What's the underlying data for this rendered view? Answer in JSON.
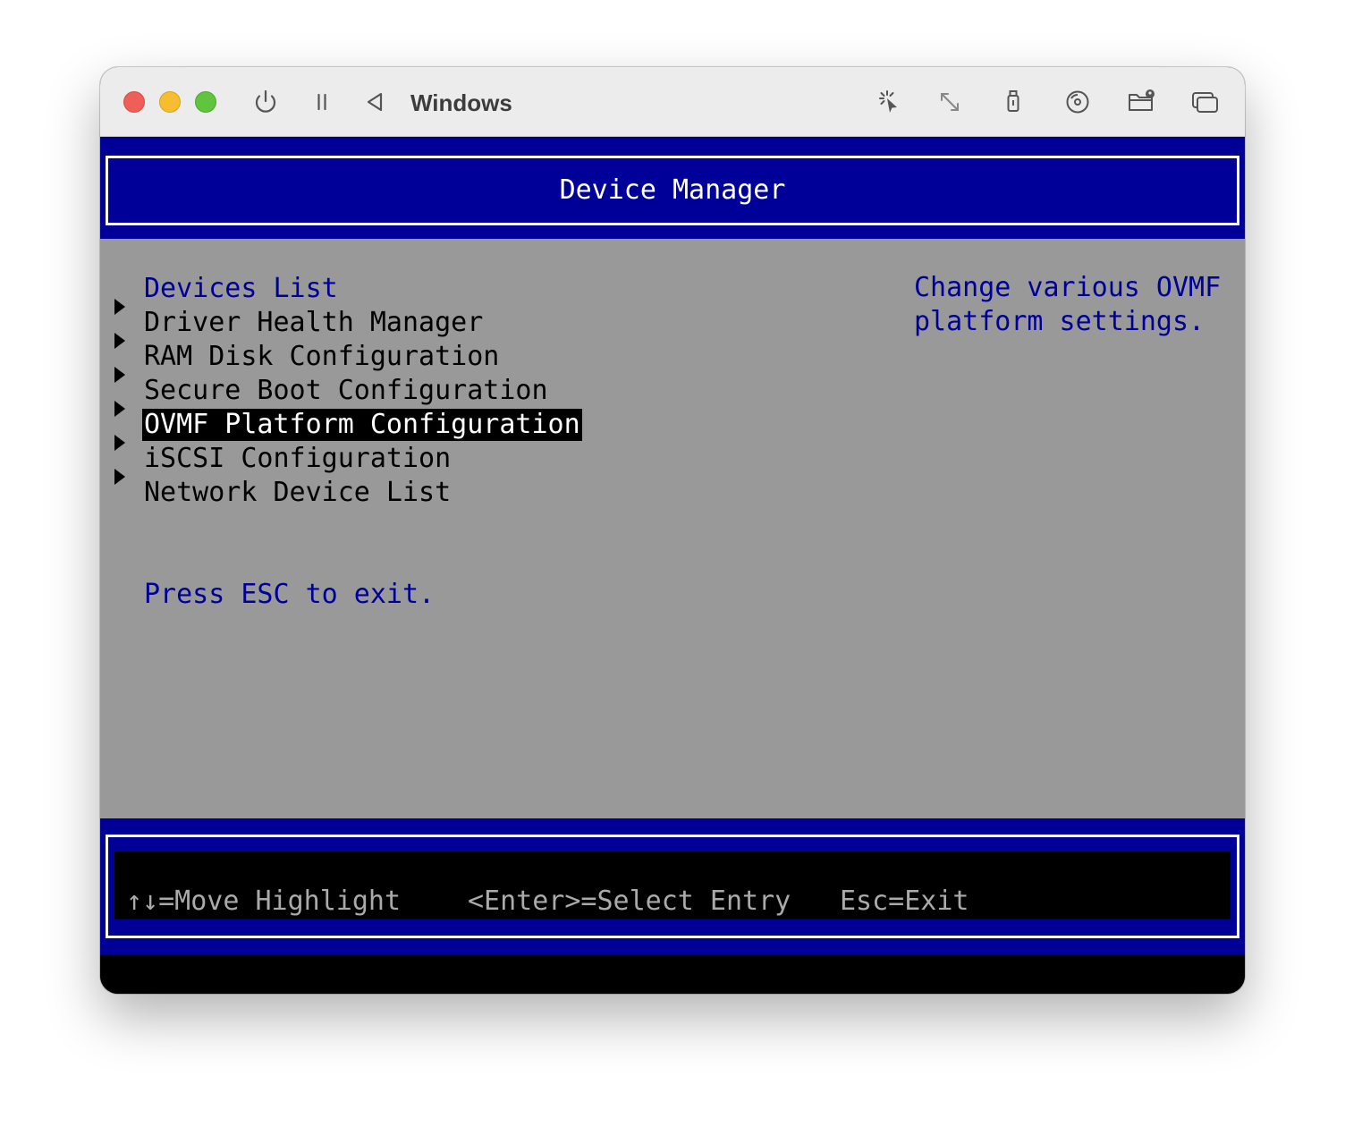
{
  "window": {
    "title": "Windows"
  },
  "toolbar_icons": [
    "power-icon",
    "pause-icon",
    "back-icon",
    "cursor-capture-icon",
    "resize-icon",
    "usb-icon",
    "disc-icon",
    "shared-folder-icon",
    "windows-icon"
  ],
  "firmware": {
    "header_title": "Device Manager",
    "section_title": "Devices List",
    "menu_items": [
      {
        "label": "Driver Health Manager",
        "selected": false
      },
      {
        "label": "RAM Disk Configuration",
        "selected": false
      },
      {
        "label": "Secure Boot Configuration",
        "selected": false
      },
      {
        "label": "OVMF Platform Configuration",
        "selected": true
      },
      {
        "label": "iSCSI Configuration",
        "selected": false
      },
      {
        "label": "Network Device List",
        "selected": false
      }
    ],
    "exit_hint": "Press ESC to exit.",
    "help_text": "Change various OVMF\nplatform settings."
  },
  "footer": {
    "move_hint": "↑↓=Move Highlight",
    "select_hint": "<Enter>=Select Entry",
    "exit_hint": "Esc=Exit"
  },
  "colors": {
    "firmware_blue": "#000099",
    "body_gray": "#999999",
    "selection_bg": "#000000"
  }
}
